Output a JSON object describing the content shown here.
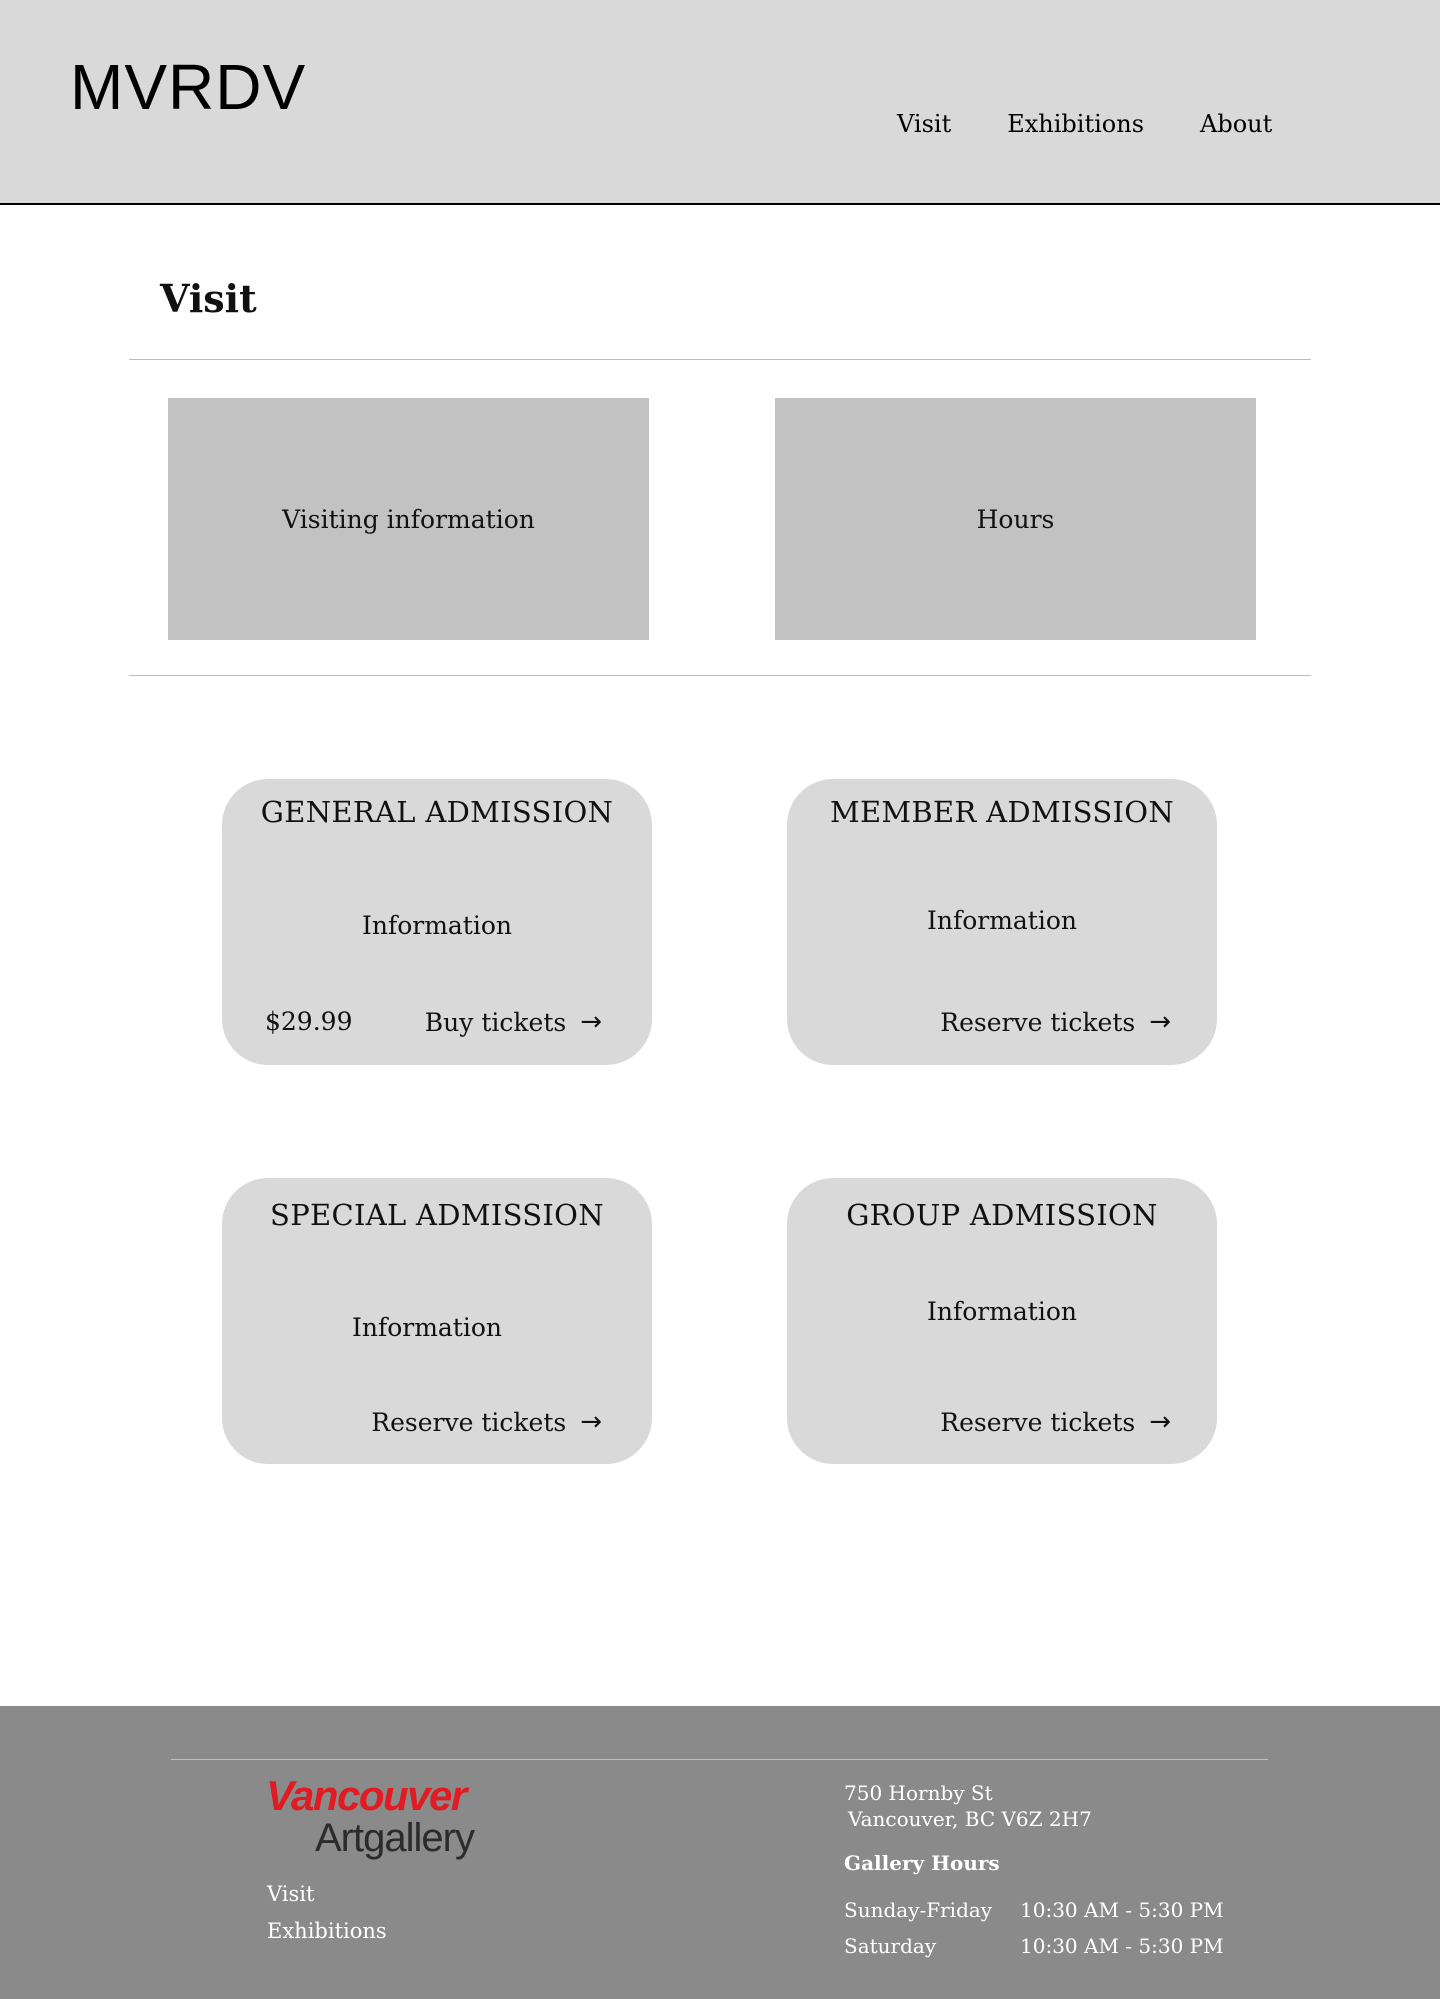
{
  "header": {
    "logo": "MVRDV",
    "nav": [
      "Visit",
      "Exhibitions",
      "About"
    ]
  },
  "page": {
    "title": "Visit",
    "tiles": [
      "Visiting information",
      "Hours"
    ]
  },
  "cards": [
    {
      "title": "GENERAL ADMISSION",
      "info": "Information",
      "price": "$29.99",
      "cta": "Buy tickets"
    },
    {
      "title": "MEMBER ADMISSION",
      "info": "Information",
      "price": "",
      "cta": "Reserve tickets"
    },
    {
      "title": "SPECIAL ADMISSION",
      "info": "Information",
      "price": "",
      "cta": "Reserve tickets"
    },
    {
      "title": "GROUP ADMISSION",
      "info": "Information",
      "price": "",
      "cta": "Reserve tickets"
    }
  ],
  "arrow_glyph": "→",
  "footer": {
    "brand_top": "Vancouver",
    "brand_bottom": "Artgallery",
    "brand_color": "#e11b22",
    "links": [
      "Visit",
      "Exhibitions"
    ],
    "address_line1": "750 Hornby St",
    "address_line2": "Vancouver, BC V6Z 2H7",
    "hours_title": "Gallery Hours",
    "hours": [
      {
        "day": "Sunday-Friday",
        "time": "10:30 AM - 5:30 PM"
      },
      {
        "day": "Saturday",
        "time": "10:30 AM - 5:30 PM"
      }
    ]
  },
  "colors": {
    "header_bg": "#d9d9d9",
    "tile_bg": "#c2c2c2",
    "card_bg": "#d9d9d9",
    "footer_bg": "#8a8a8a"
  }
}
